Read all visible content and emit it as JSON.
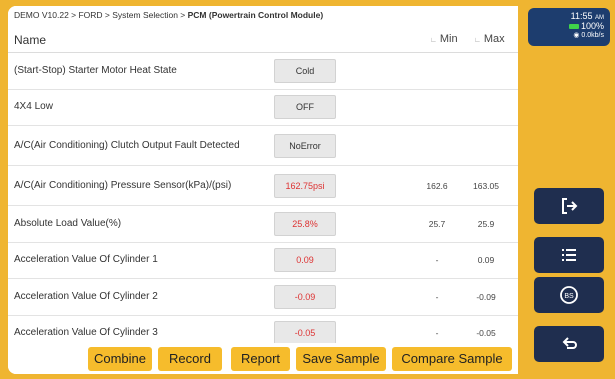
{
  "breadcrumb": {
    "prefix": "DEMO V10.22 > FORD > System Selection > ",
    "current": "PCM (Powertrain Control Module)"
  },
  "table": {
    "col_name": "Name",
    "col_min": "Min",
    "col_max": "Max",
    "rows": [
      {
        "name": "(Start-Stop) Starter Motor Heat State",
        "value": "Cold",
        "min": "",
        "max": "",
        "alert": false
      },
      {
        "name": "4X4 Low",
        "value": "OFF",
        "min": "",
        "max": "",
        "alert": false
      },
      {
        "name": "A/C(Air Conditioning) Clutch Output Fault Detected",
        "value": "NoError",
        "min": "",
        "max": "",
        "alert": false
      },
      {
        "name": "A/C(Air Conditioning) Pressure Sensor(kPa)/(psi)",
        "value": "162.75psi",
        "min": "162.6",
        "max": "163.05",
        "alert": true
      },
      {
        "name": "Absolute Load Value(%)",
        "value": "25.8%",
        "min": "25.7",
        "max": "25.9",
        "alert": true
      },
      {
        "name": "Acceleration Value Of Cylinder 1",
        "value": "0.09",
        "min": "-",
        "max": "0.09",
        "alert": true
      },
      {
        "name": "Acceleration Value Of Cylinder 2",
        "value": "-0.09",
        "min": "-",
        "max": "-0.09",
        "alert": true
      },
      {
        "name": "Acceleration Value Of Cylinder 3",
        "value": "-0.05",
        "min": "-",
        "max": "-0.05",
        "alert": true
      }
    ]
  },
  "toolbar": {
    "combine": "Combine",
    "record": "Record",
    "report": "Report",
    "save_sample": "Save Sample",
    "compare_sample": "Compare Sample"
  },
  "status": {
    "time": "11:55",
    "ampm": "AM",
    "battery": "100%",
    "network": "0.0kb/s"
  },
  "side_buttons": [
    "exit-icon",
    "list-icon",
    "bs-icon",
    "back-icon"
  ],
  "colors": {
    "accent": "#efb531",
    "button": "#f6bc2c",
    "alert": "#dd3333",
    "side": "#1f2e4f"
  }
}
